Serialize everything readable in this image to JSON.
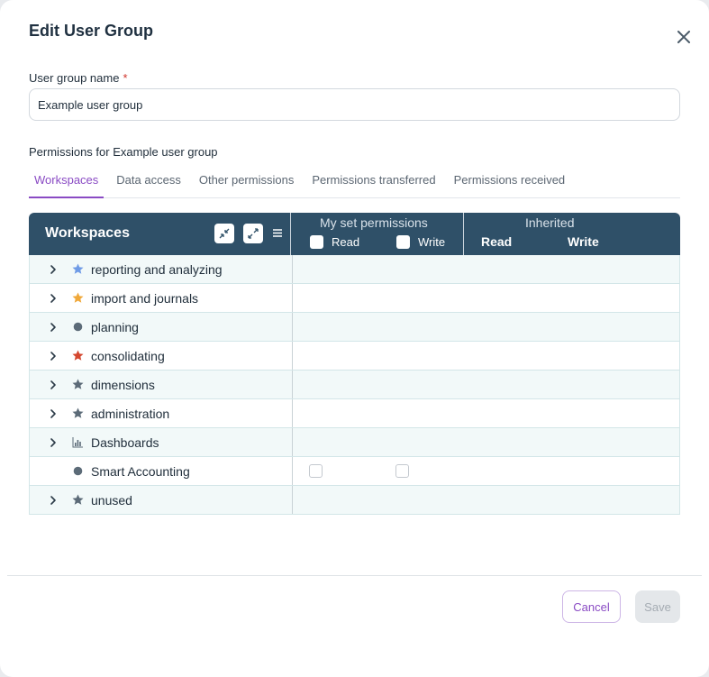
{
  "dialog": {
    "title": "Edit User Group",
    "close_icon": "close-icon"
  },
  "form": {
    "name_label": "User group name",
    "required_mark": "*",
    "name_value": "Example user group",
    "permissions_label": "Permissions for Example user group"
  },
  "tabs": [
    {
      "label": "Workspaces",
      "active": true
    },
    {
      "label": "Data access",
      "active": false
    },
    {
      "label": "Other permissions",
      "active": false
    },
    {
      "label": "Permissions transferred",
      "active": false
    },
    {
      "label": "Permissions received",
      "active": false
    }
  ],
  "table": {
    "header": {
      "workspaces": "Workspaces",
      "my_set_permissions": "My set permissions",
      "read": "Read",
      "write": "Write",
      "inherited": "Inherited",
      "inherited_read": "Read",
      "inherited_write": "Write"
    },
    "rows": [
      {
        "label": "reporting and analyzing",
        "icon": "star-icon",
        "icon_color": "#6f9be6",
        "expandable": true,
        "has_checkboxes": false
      },
      {
        "label": "import and journals",
        "icon": "star-icon",
        "icon_color": "#f0a83a",
        "expandable": true,
        "has_checkboxes": false
      },
      {
        "label": "planning",
        "icon": "dot-icon",
        "icon_color": "#5c6b78",
        "expandable": true,
        "has_checkboxes": false
      },
      {
        "label": "consolidating",
        "icon": "star-icon",
        "icon_color": "#d4472f",
        "expandable": true,
        "has_checkboxes": false
      },
      {
        "label": "dimensions",
        "icon": "star-icon",
        "icon_color": "#5c6b78",
        "expandable": true,
        "has_checkboxes": false
      },
      {
        "label": "administration",
        "icon": "star-icon",
        "icon_color": "#5c6b78",
        "expandable": true,
        "has_checkboxes": false
      },
      {
        "label": "Dashboards",
        "icon": "chart-icon",
        "icon_color": "#5c6b78",
        "expandable": true,
        "has_checkboxes": false
      },
      {
        "label": "Smart Accounting",
        "icon": "dot-icon",
        "icon_color": "#5c6b78",
        "expandable": false,
        "has_checkboxes": true
      },
      {
        "label": "unused",
        "icon": "star-icon",
        "icon_color": "#5c6b78",
        "expandable": true,
        "has_checkboxes": false
      }
    ]
  },
  "footer": {
    "cancel_label": "Cancel",
    "save_label": "Save"
  },
  "colors": {
    "accent": "#8a4bc4",
    "table_header": "#2f5068"
  }
}
